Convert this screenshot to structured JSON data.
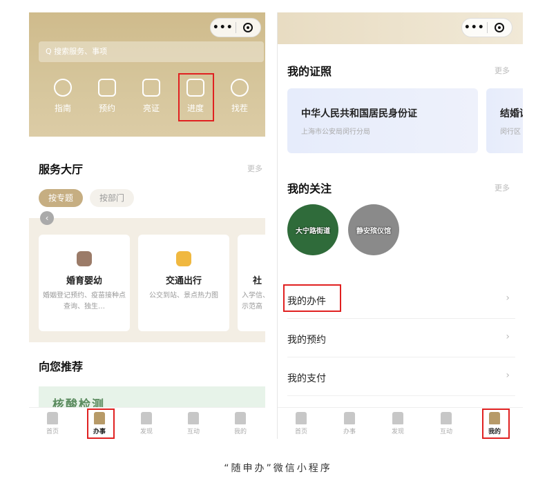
{
  "left": {
    "search_placeholder": "Q 搜索服务、事项",
    "quick_actions": [
      {
        "label": "指南",
        "icon": "gauge-icon"
      },
      {
        "label": "预约",
        "icon": "calendar-icon"
      },
      {
        "label": "亮证",
        "icon": "card-icon"
      },
      {
        "label": "进度",
        "icon": "bar-chart-icon"
      },
      {
        "label": "找茬",
        "icon": "search-icon"
      }
    ],
    "service_hall": {
      "title": "服务大厅",
      "more": "更多",
      "tabs": [
        "按专题",
        "按部门"
      ],
      "cards": [
        {
          "title": "婚育婴幼",
          "desc": "婚姻登记预约、疫苗接种点查询、独生…",
          "color": "#9b7b68"
        },
        {
          "title": "交通出行",
          "desc": "公交到站、景点热力图",
          "color": "#f0b840"
        },
        {
          "title": "社",
          "desc": "入学信、示范高",
          "color": "#cccccc"
        }
      ]
    },
    "recommend": {
      "title": "向您推荐",
      "banner_text": "核酸检测"
    },
    "tabbar": [
      {
        "label": "首页",
        "icon": "home-icon"
      },
      {
        "label": "办事",
        "icon": "brush-icon",
        "active": true
      },
      {
        "label": "发现",
        "icon": "gate-icon"
      },
      {
        "label": "互动",
        "icon": "hands-icon"
      },
      {
        "label": "我的",
        "icon": "user-icon"
      }
    ]
  },
  "right": {
    "certs": {
      "title": "我的证照",
      "more": "更多",
      "items": [
        {
          "title": "中华人民共和国居民身份证",
          "sub": "上海市公安局闵行分局"
        },
        {
          "title": "结婚证",
          "sub": "闵行区"
        }
      ]
    },
    "follows": {
      "title": "我的关注",
      "more": "更多",
      "items": [
        {
          "label": "大宁路街道",
          "color": "#2f6b3a"
        },
        {
          "label": "静安殡仪馆",
          "color": "#8a8a8a"
        }
      ]
    },
    "rows": [
      "我的办件",
      "我的预约",
      "我的支付"
    ],
    "chevron": "›",
    "tabbar": [
      {
        "label": "首页",
        "icon": "home-icon"
      },
      {
        "label": "办事",
        "icon": "brush-icon"
      },
      {
        "label": "发现",
        "icon": "gate-icon"
      },
      {
        "label": "互动",
        "icon": "hands-icon"
      },
      {
        "label": "我的",
        "icon": "user-icon",
        "active": true
      }
    ]
  },
  "capsule": {
    "dots": "•••"
  },
  "caption": "“随申办”微信小程序",
  "highlight_color": "#e02020"
}
